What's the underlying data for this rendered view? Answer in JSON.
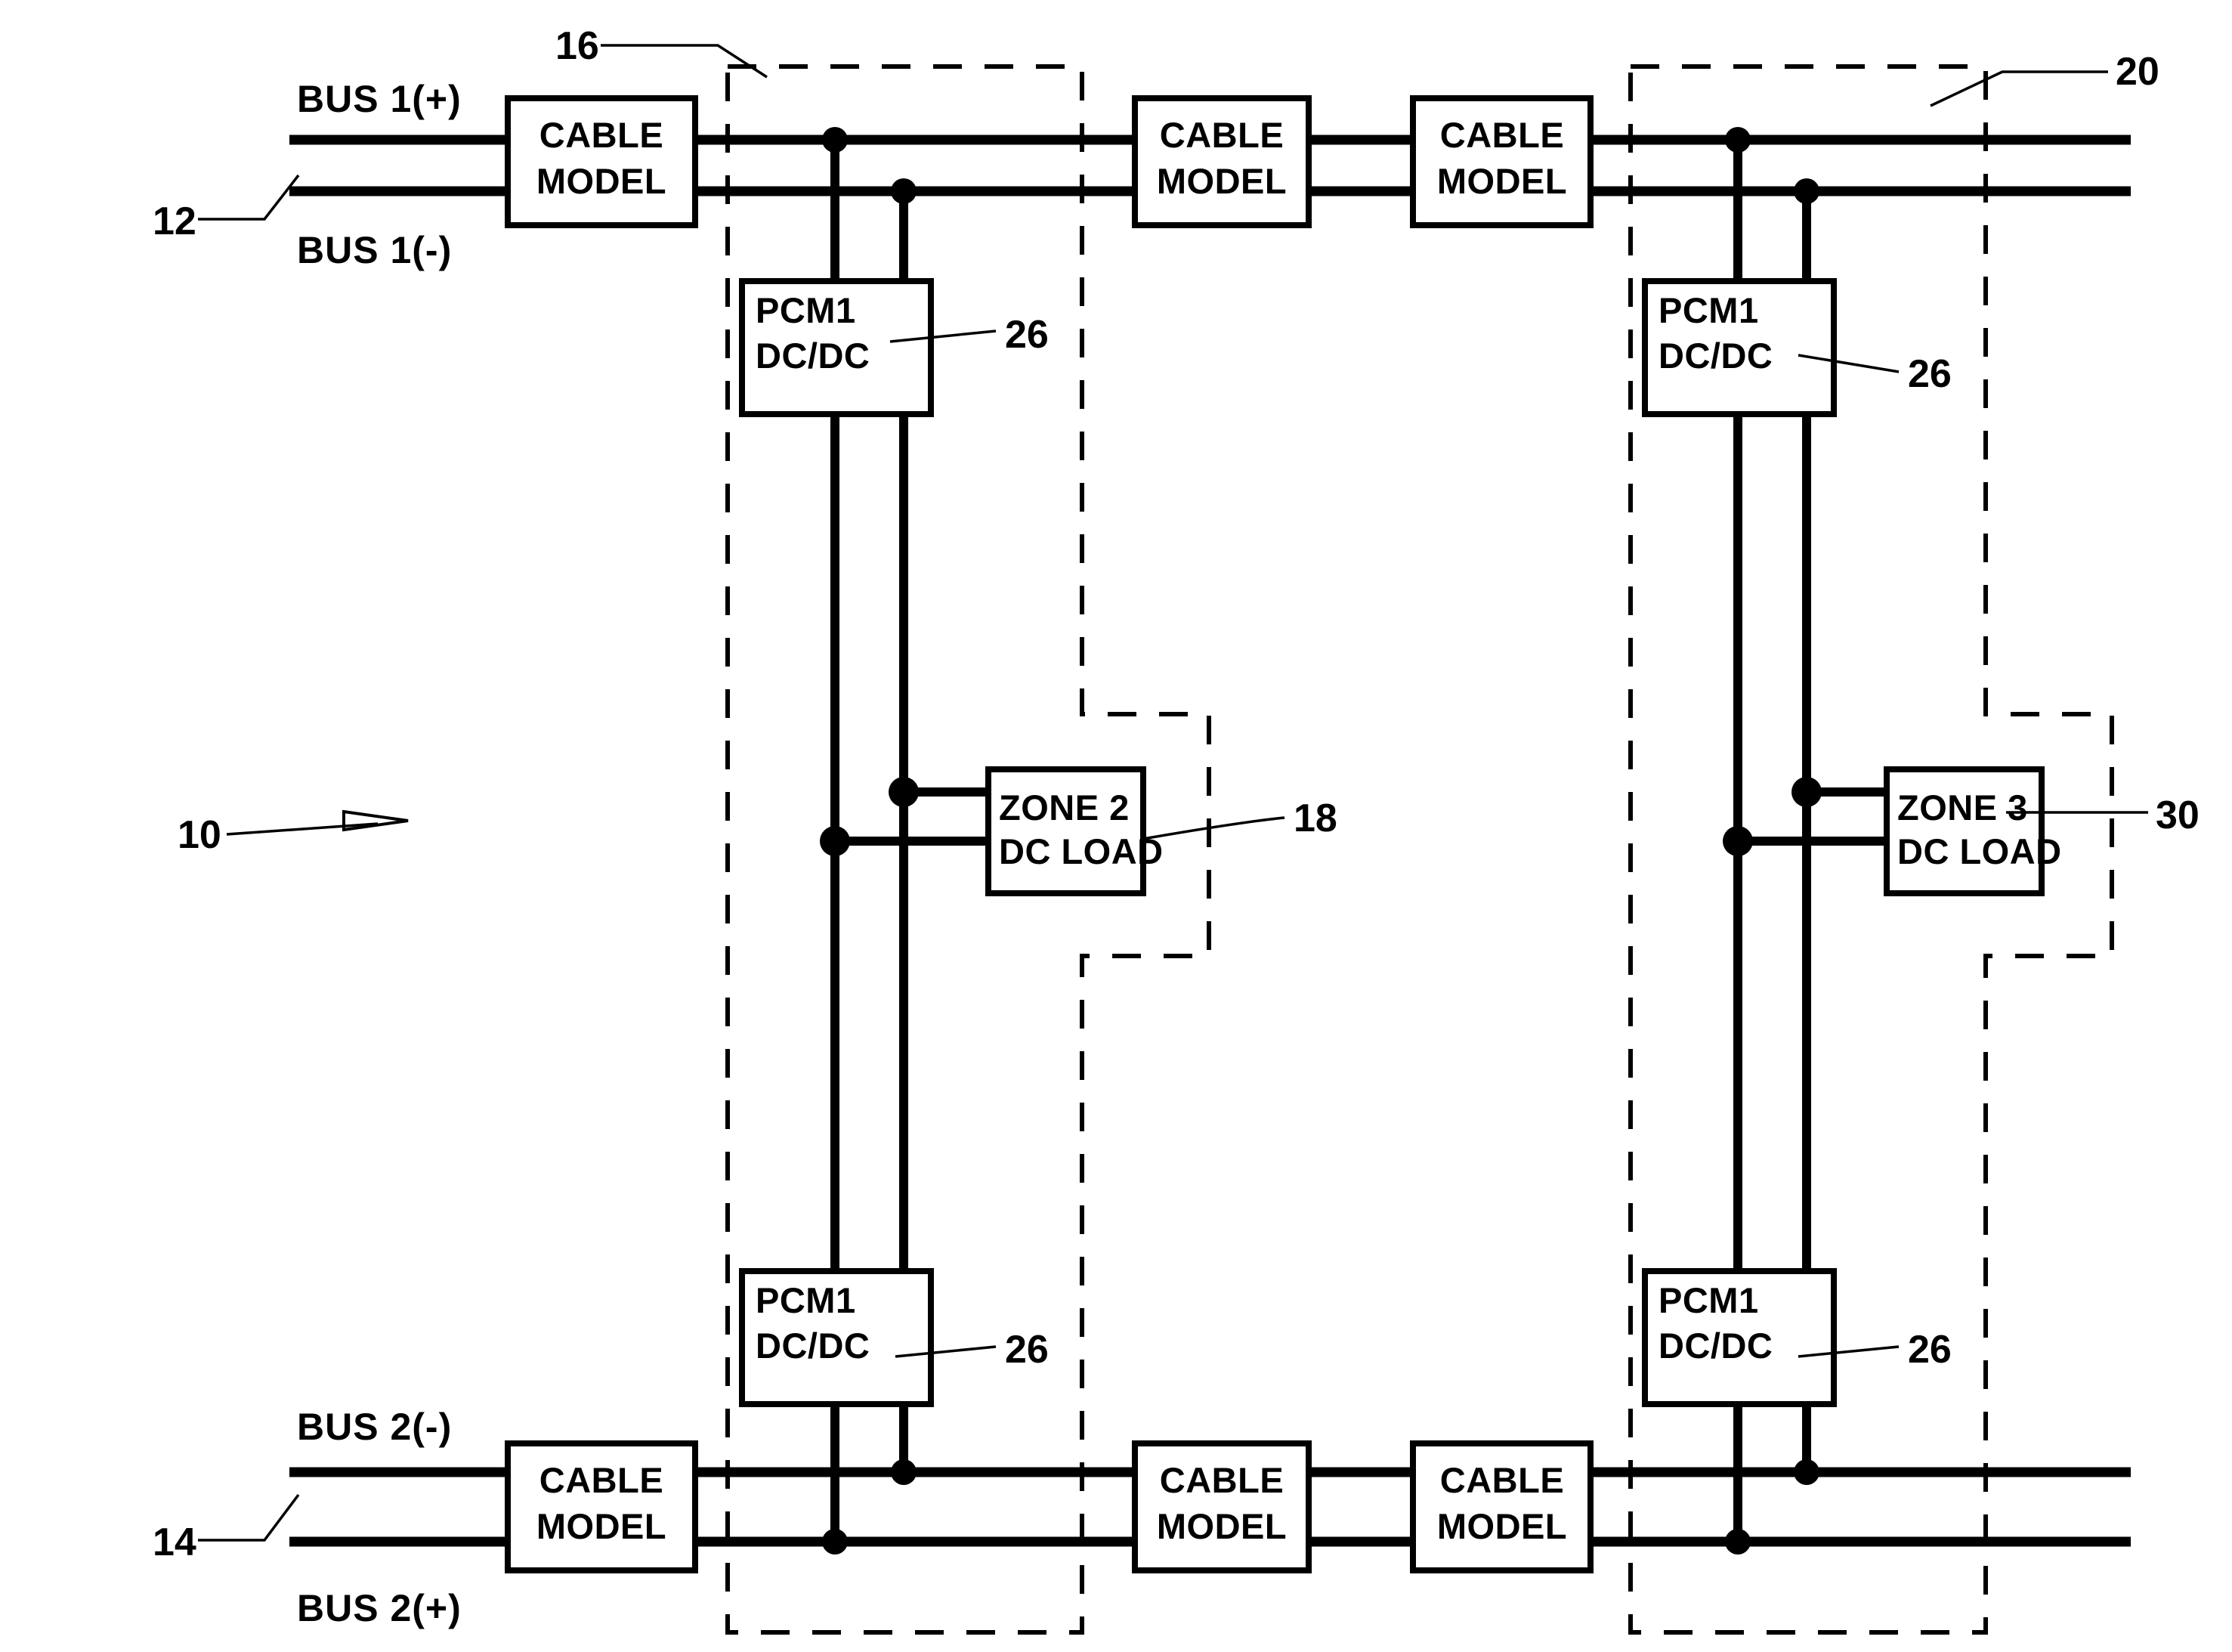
{
  "figure": {
    "type": "patent-schematic-diagram",
    "title_ref": "10",
    "background": "#ffffff",
    "ink": "#000000"
  },
  "bus_labels": {
    "bus1_pos": "BUS  1(+)",
    "bus1_neg": "BUS  1(-)",
    "bus2_neg": "BUS  2(-)",
    "bus2_pos": "BUS  2(+)"
  },
  "reference_numerals": {
    "overall_system": "10",
    "bus1": "12",
    "bus2": "14",
    "zone_left": "16",
    "zone2_load": "18",
    "zone_right": "20",
    "pcm_top_left": "26",
    "pcm_top_right": "26",
    "pcm_bottom_left": "26",
    "pcm_bottom_right": "26",
    "zone3_load": "30"
  },
  "components": {
    "cable_models": [
      {
        "id": "cable-top-left",
        "line1": "CABLE",
        "line2": "MODEL"
      },
      {
        "id": "cable-top-mid-a",
        "line1": "CABLE",
        "line2": "MODEL"
      },
      {
        "id": "cable-top-mid-b",
        "line1": "CABLE",
        "line2": "MODEL"
      },
      {
        "id": "cable-bot-left",
        "line1": "CABLE",
        "line2": "MODEL"
      },
      {
        "id": "cable-bot-mid-a",
        "line1": "CABLE",
        "line2": "MODEL"
      },
      {
        "id": "cable-bot-mid-b",
        "line1": "CABLE",
        "line2": "MODEL"
      }
    ],
    "pcm_modules": [
      {
        "id": "pcm-top-left",
        "line1": "PCM1",
        "line2": "DC/DC",
        "ref": "26"
      },
      {
        "id": "pcm-top-right",
        "line1": "PCM1",
        "line2": "DC/DC",
        "ref": "26"
      },
      {
        "id": "pcm-bottom-left",
        "line1": "PCM1",
        "line2": "DC/DC",
        "ref": "26"
      },
      {
        "id": "pcm-bottom-right",
        "line1": "PCM1",
        "line2": "DC/DC",
        "ref": "26"
      }
    ],
    "dc_loads": [
      {
        "id": "zone2-load",
        "line1": "ZONE  2",
        "line2": "DC  LOAD",
        "ref": "18"
      },
      {
        "id": "zone3-load",
        "line1": "ZONE  3",
        "line2": "DC  LOAD",
        "ref": "30"
      }
    ]
  },
  "zones": [
    {
      "id": "zone-left",
      "ref": "16",
      "contains": [
        "pcm-top-left",
        "pcm-bottom-left",
        "zone2-load"
      ]
    },
    {
      "id": "zone-right",
      "ref": "20",
      "contains": [
        "pcm-top-right",
        "pcm-bottom-right",
        "zone3-load"
      ]
    }
  ]
}
